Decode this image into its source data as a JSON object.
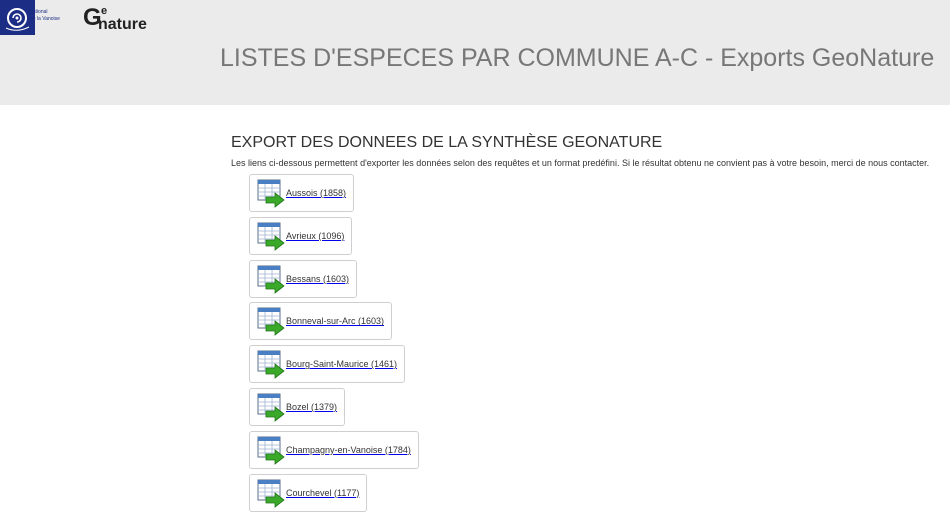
{
  "header": {
    "logo_pnv_lines": [
      "national",
      "de la Vanoise"
    ],
    "logo_geonature": "Geonature",
    "title": "LISTES D'ESPECES PAR COMMUNE A-C - Exports GeoNature"
  },
  "main": {
    "section_title": "EXPORT DES DONNEES DE LA SYNTHÈSE GEONATURE",
    "intro": "Les liens ci-dessous permettent d'exporter les données selon des requêtes et un format predéfini. Si le résultat obtenu ne convient pas à votre besoin, merci de nous contacter.",
    "exports": [
      {
        "label": "Aussois (1858)"
      },
      {
        "label": "Avrieux (1096)"
      },
      {
        "label": "Bessans (1603)"
      },
      {
        "label": "Bonneval-sur-Arc (1603)"
      },
      {
        "label": "Bourg-Saint-Maurice (1461)"
      },
      {
        "label": "Bozel (1379)"
      },
      {
        "label": "Champagny-en-Vanoise (1784)"
      },
      {
        "label": "Courchevel (1177)"
      }
    ]
  },
  "colors": {
    "header_bg": "#ebebeb",
    "pnv_blue": "#1c2d86",
    "title_gray": "#777777",
    "export_icon_green": "#3aa829"
  }
}
